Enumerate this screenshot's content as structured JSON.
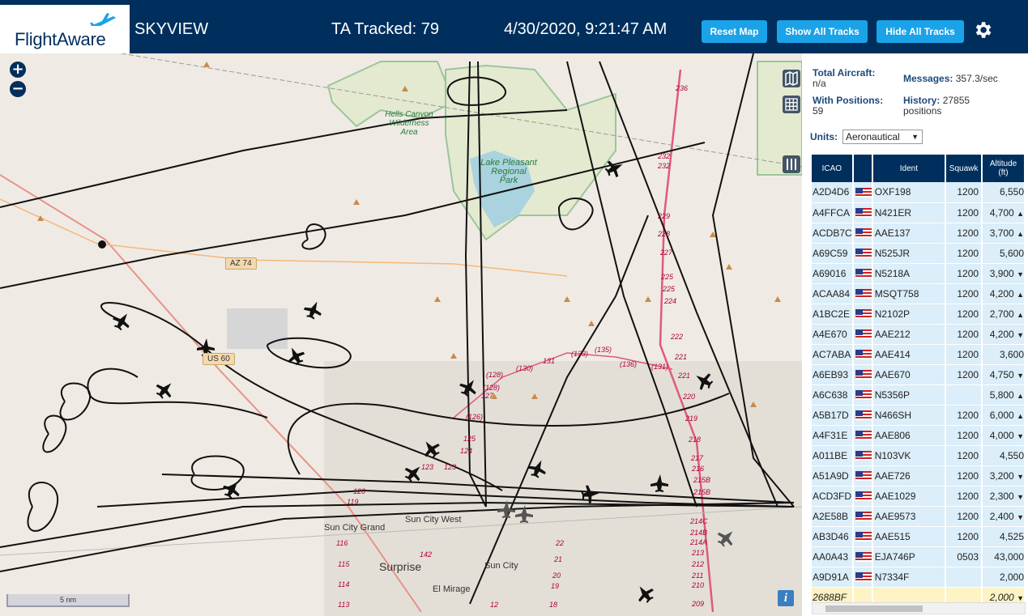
{
  "header": {
    "logo": "FlightAware",
    "title": "SKYVIEW",
    "tracked": "TA Tracked: 79",
    "datetime": "4/30/2020, 9:21:47 AM",
    "reset_label": "Reset Map",
    "show_label": "Show All Tracks",
    "hide_label": "Hide All Tracks"
  },
  "map": {
    "zoom_in": "+",
    "zoom_out": "−",
    "scale_label": "5 nm",
    "info": "i",
    "places": {
      "hells_canyon": "Hells Canyon\nWilderness\nArea",
      "lake_pleasant": "Lake Pleasant\nRegional\nPark",
      "sun_city_grand": "Sun City Grand",
      "sun_city_west": "Sun City West",
      "surprise": "Surprise",
      "sun_city": "Sun City",
      "el_mirage": "El Mirage"
    },
    "shields": {
      "az74": "AZ 74",
      "us60": "US 60"
    },
    "road_numbers": [
      "236",
      "232",
      "232",
      "229",
      "228",
      "227",
      "225",
      "225",
      "224",
      "222",
      "221",
      "221",
      "220",
      "219",
      "218",
      "217",
      "216",
      "215B",
      "215B",
      "214C",
      "214B",
      "214A",
      "213",
      "212",
      "211",
      "210",
      "209",
      "131",
      "(133)",
      "(135)",
      "(136)",
      "(130)",
      "(131)",
      "(128)",
      "(128)",
      "127",
      "(126)",
      "125",
      "124",
      "123",
      "123",
      "120",
      "119",
      "116",
      "115",
      "114",
      "113",
      "142",
      "22",
      "21",
      "20",
      "19",
      "18",
      "12"
    ]
  },
  "stats": {
    "total_label": "Total Aircraft:",
    "total_value": "n/a",
    "positions_label": "With Positions:",
    "positions_value": "59",
    "messages_label": "Messages:",
    "messages_value": "357.3/sec",
    "history_label": "History:",
    "history_value": "27855",
    "history_unit": "positions",
    "units_label": "Units:",
    "units_value": "Aeronautical"
  },
  "table": {
    "columns": [
      "ICAO",
      "Ident",
      "Squawk",
      "Altitude\n(ft)"
    ],
    "rows": [
      {
        "icao": "A2D4D6",
        "ident": "OXF198",
        "squawk": "1200",
        "alt": "6,550",
        "trend": ""
      },
      {
        "icao": "A4FFCA",
        "ident": "N421ER",
        "squawk": "1200",
        "alt": "4,700",
        "trend": "▲"
      },
      {
        "icao": "ACDB7C",
        "ident": "AAE137",
        "squawk": "1200",
        "alt": "3,700",
        "trend": "▲"
      },
      {
        "icao": "A69C59",
        "ident": "N525JR",
        "squawk": "1200",
        "alt": "5,600",
        "trend": ""
      },
      {
        "icao": "A69016",
        "ident": "N5218A",
        "squawk": "1200",
        "alt": "3,900",
        "trend": "▼"
      },
      {
        "icao": "ACAA84",
        "ident": "MSQT758",
        "squawk": "1200",
        "alt": "4,200",
        "trend": "▲"
      },
      {
        "icao": "A1BC2E",
        "ident": "N2102P",
        "squawk": "1200",
        "alt": "2,700",
        "trend": "▲"
      },
      {
        "icao": "A4E670",
        "ident": "AAE212",
        "squawk": "1200",
        "alt": "4,200",
        "trend": "▼"
      },
      {
        "icao": "AC7ABA",
        "ident": "AAE414",
        "squawk": "1200",
        "alt": "3,600",
        "trend": ""
      },
      {
        "icao": "A6EB93",
        "ident": "AAE670",
        "squawk": "1200",
        "alt": "4,750",
        "trend": "▼"
      },
      {
        "icao": "A6C638",
        "ident": "N5356P",
        "squawk": "",
        "alt": "5,800",
        "trend": "▲"
      },
      {
        "icao": "A5B17D",
        "ident": "N466SH",
        "squawk": "1200",
        "alt": "6,000",
        "trend": "▲"
      },
      {
        "icao": "A4F31E",
        "ident": "AAE806",
        "squawk": "1200",
        "alt": "4,000",
        "trend": "▼"
      },
      {
        "icao": "A011BE",
        "ident": "N103VK",
        "squawk": "1200",
        "alt": "4,550",
        "trend": ""
      },
      {
        "icao": "A51A9D",
        "ident": "AAE726",
        "squawk": "1200",
        "alt": "3,200",
        "trend": "▼"
      },
      {
        "icao": "ACD3FD",
        "ident": "AAE1029",
        "squawk": "1200",
        "alt": "2,300",
        "trend": "▼"
      },
      {
        "icao": "A2E58B",
        "ident": "AAE9573",
        "squawk": "1200",
        "alt": "2,400",
        "trend": "▼"
      },
      {
        "icao": "AB3D46",
        "ident": "AAE515",
        "squawk": "1200",
        "alt": "4,525",
        "trend": ""
      },
      {
        "icao": "AA0A43",
        "ident": "EJA746P",
        "squawk": "0503",
        "alt": "43,000",
        "trend": ""
      },
      {
        "icao": "A9D91A",
        "ident": "N7334F",
        "squawk": "",
        "alt": "2,000",
        "trend": ""
      },
      {
        "icao": "2688BF",
        "ident": "",
        "squawk": "",
        "alt": "2,000",
        "trend": "▼"
      }
    ]
  },
  "colors": {
    "header": "#002f5d",
    "button": "#1aa3e8",
    "row": "#dbeef9",
    "highlight": "#fdf3c4"
  }
}
